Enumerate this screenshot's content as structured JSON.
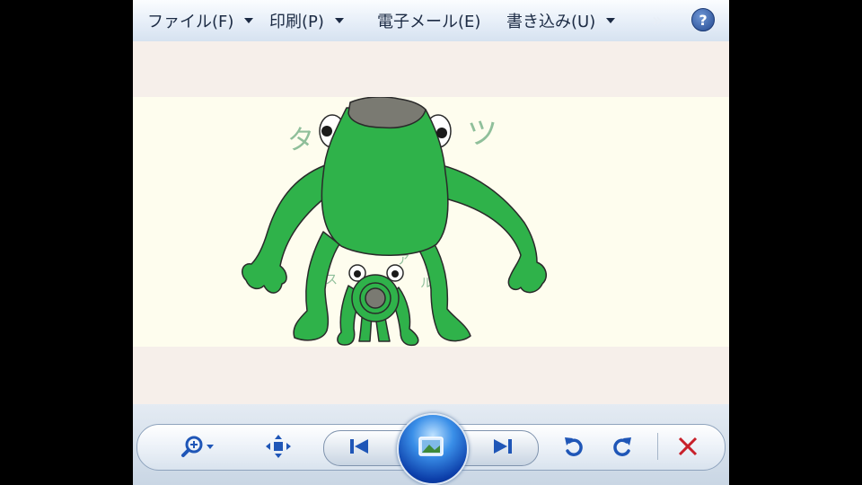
{
  "menubar": {
    "file": "ファイル(F)",
    "print": "印刷(P)",
    "email": "電子メール(E)",
    "burn": "書き込み(U)",
    "more": "»",
    "help": "?"
  },
  "image": {
    "description_icons": "drawing-canvas",
    "kana_big_left": "タ",
    "kana_big_right": "ツ",
    "kana_small_1": "ス",
    "kana_small_2": "ア",
    "kana_small_3": "ル"
  },
  "toolbar": {
    "zoom_icon": "zoom-icon",
    "fit_icon": "fit-window-icon",
    "prev_icon": "previous-icon",
    "slideshow_icon": "slideshow-icon",
    "next_icon": "next-icon",
    "rotate_ccw_icon": "rotate-counterclockwise-icon",
    "rotate_cw_icon": "rotate-clockwise-icon",
    "delete_icon": "delete-icon"
  },
  "colors": {
    "accent": "#1f56b7",
    "delete": "#c8202a",
    "frog_green": "#2fb24a"
  }
}
